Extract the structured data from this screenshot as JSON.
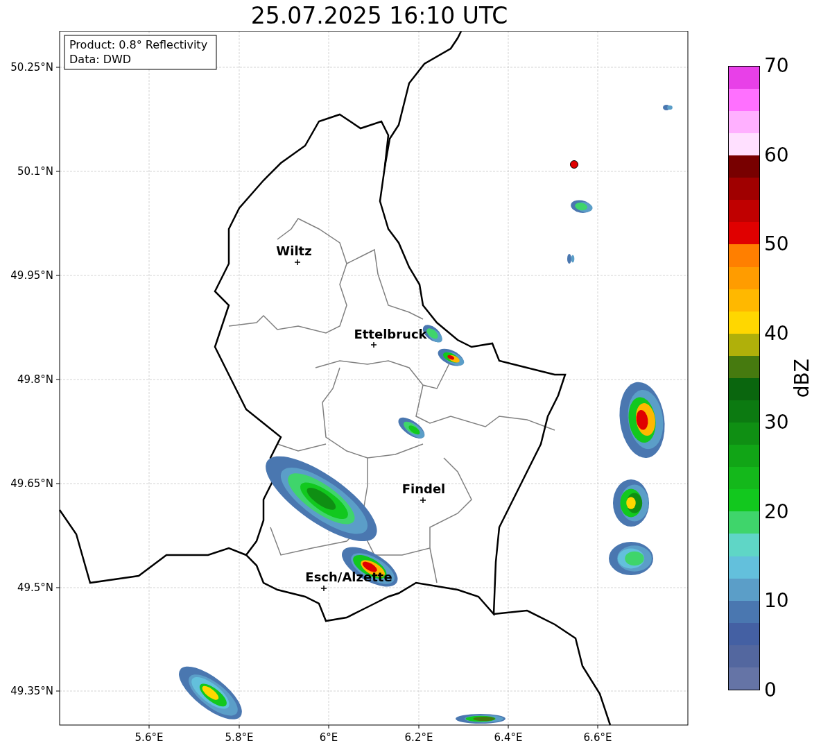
{
  "title": "25.07.2025 16:10 UTC",
  "info_box": {
    "lines": [
      "Product: 0.8° Reflectivity",
      "Data: DWD"
    ]
  },
  "map": {
    "yticks": [
      "50.25°N",
      "50.1°N",
      "49.95°N",
      "49.8°N",
      "49.65°N",
      "49.5°N",
      "49.35°N"
    ],
    "xticks": [
      "5.6°E",
      "5.8°E",
      "6°E",
      "6.2°E",
      "6.4°E",
      "6.6°E"
    ],
    "cities": [
      {
        "name": "Wiltz"
      },
      {
        "name": "Ettelbruck"
      },
      {
        "name": "Findel"
      },
      {
        "name": "Esch/Alzette"
      }
    ]
  },
  "colorbar": {
    "label": "dBZ",
    "ticks": [
      "70",
      "60",
      "50",
      "40",
      "30",
      "20",
      "10",
      "0"
    ],
    "bins": [
      {
        "color": "#6574a6"
      },
      {
        "color": "#53679f"
      },
      {
        "color": "#4460a3"
      },
      {
        "color": "#4a77b0"
      },
      {
        "color": "#5b9ec8"
      },
      {
        "color": "#63c0dc"
      },
      {
        "color": "#5fd6c6"
      },
      {
        "color": "#3fd56b"
      },
      {
        "color": "#12c81e"
      },
      {
        "color": "#14b81b"
      },
      {
        "color": "#11a516"
      },
      {
        "color": "#0f8f13"
      },
      {
        "color": "#0c7a11"
      },
      {
        "color": "#0a660e"
      },
      {
        "color": "#467a0f"
      },
      {
        "color": "#b0b00a"
      },
      {
        "color": "#ffd700"
      },
      {
        "color": "#ffb800"
      },
      {
        "color": "#ff9c00"
      },
      {
        "color": "#ff7f00"
      },
      {
        "color": "#e00000"
      },
      {
        "color": "#c00000"
      },
      {
        "color": "#a00000"
      },
      {
        "color": "#780000"
      },
      {
        "color": "#ffe0ff"
      },
      {
        "color": "#ffb0ff"
      },
      {
        "color": "#ff70ff"
      },
      {
        "color": "#e840e8"
      }
    ]
  }
}
